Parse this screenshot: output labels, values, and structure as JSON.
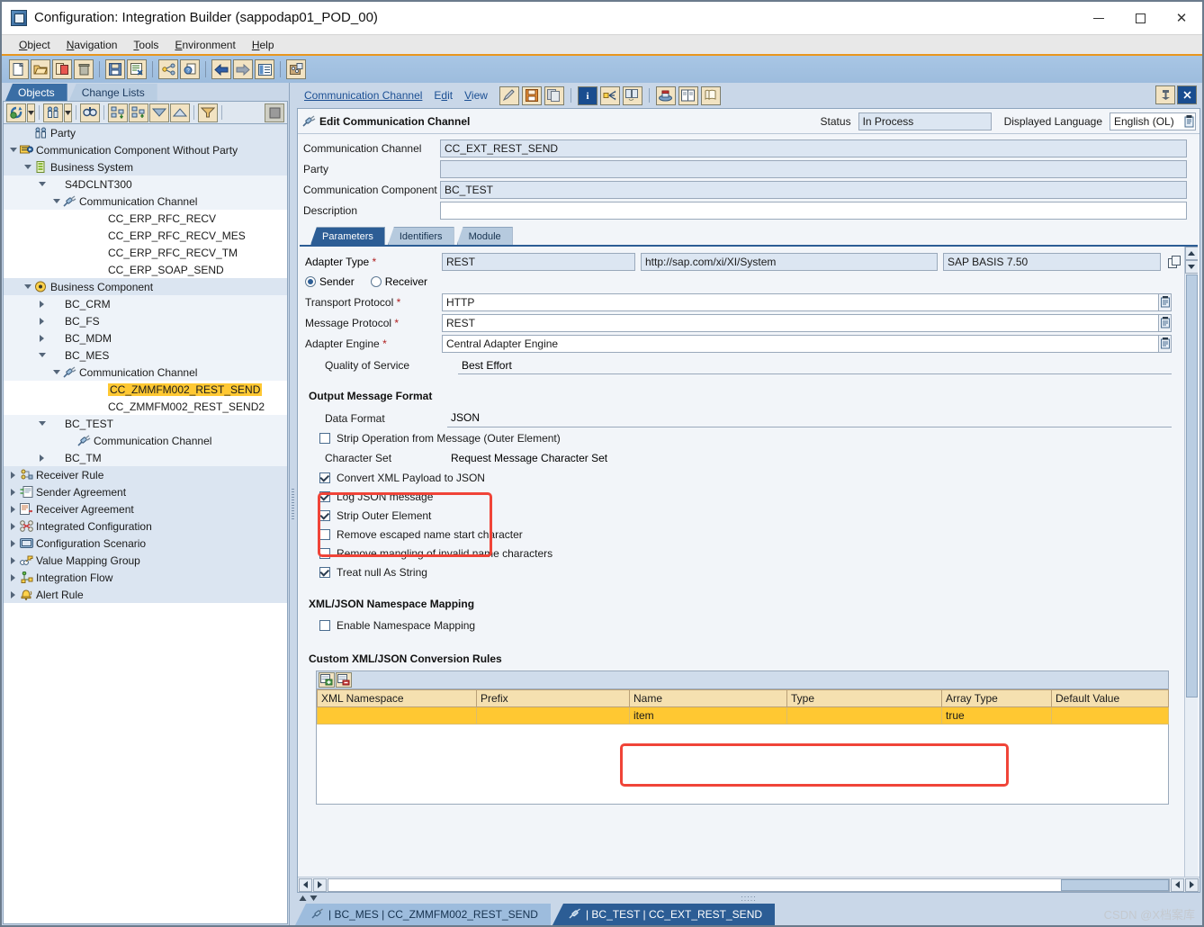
{
  "window": {
    "title": "Configuration: Integration Builder (sappodap01_POD_00)",
    "icon": "app-icon",
    "minimize": "—",
    "maximize": "□",
    "close": "✕"
  },
  "menubar": {
    "items": [
      {
        "label": "Object",
        "accel": "O"
      },
      {
        "label": "Navigation",
        "accel": "N"
      },
      {
        "label": "Tools",
        "accel": "T"
      },
      {
        "label": "Environment",
        "accel": "E"
      },
      {
        "label": "Help",
        "accel": "H"
      }
    ]
  },
  "toolbar": {
    "buttons": [
      {
        "name": "new-icon"
      },
      {
        "name": "open-icon"
      },
      {
        "name": "copy-icon"
      },
      {
        "name": "delete-icon"
      },
      {
        "name": "save-icon"
      },
      {
        "name": "activate-icon"
      },
      {
        "name": "where-used-icon"
      },
      {
        "name": "help-object-icon"
      },
      {
        "name": "back-icon"
      },
      {
        "name": "forward-icon"
      },
      {
        "name": "list-icon"
      },
      {
        "name": "settings-icon"
      }
    ]
  },
  "left_panel": {
    "tabs": [
      {
        "label": "Objects",
        "active": true
      },
      {
        "label": "Change Lists",
        "active": false
      }
    ],
    "toolbar_buttons": [
      {
        "name": "refresh-icon"
      },
      {
        "name": "refresh-dropdown-icon"
      },
      {
        "name": "party-filter-icon"
      },
      {
        "name": "party-dropdown-icon"
      },
      {
        "name": "find-icon"
      },
      {
        "name": "expand-tree-icon"
      },
      {
        "name": "collapse-tree-icon"
      },
      {
        "name": "move-down-icon"
      },
      {
        "name": "move-up-icon"
      },
      {
        "name": "filter-icon"
      },
      {
        "name": "stop-icon"
      }
    ],
    "tree": [
      {
        "label": "Party",
        "indent": 1,
        "twist": "none",
        "icon": "party-icon",
        "shade": "shade"
      },
      {
        "label": "Communication Component Without Party",
        "indent": 0,
        "twist": "down",
        "icon": "component-icon",
        "shade": "shade"
      },
      {
        "label": "Business System",
        "indent": 1,
        "twist": "down",
        "icon": "business-system-icon",
        "shade": "shade"
      },
      {
        "label": "S4DCLNT300",
        "indent": 2,
        "twist": "down",
        "icon": "none",
        "shade": "shade2"
      },
      {
        "label": "Communication Channel",
        "indent": 3,
        "twist": "down",
        "icon": "channel-icon",
        "shade": "shade2"
      },
      {
        "label": "CC_ERP_RFC_RECV",
        "indent": 5,
        "twist": "none",
        "icon": "none",
        "shade": "plainw"
      },
      {
        "label": "CC_ERP_RFC_RECV_MES",
        "indent": 5,
        "twist": "none",
        "icon": "none",
        "shade": "plainw"
      },
      {
        "label": "CC_ERP_RFC_RECV_TM",
        "indent": 5,
        "twist": "none",
        "icon": "none",
        "shade": "plainw"
      },
      {
        "label": "CC_ERP_SOAP_SEND",
        "indent": 5,
        "twist": "none",
        "icon": "none",
        "shade": "plainw"
      },
      {
        "label": "Business Component",
        "indent": 1,
        "twist": "down",
        "icon": "business-component-icon",
        "shade": "shade"
      },
      {
        "label": "BC_CRM",
        "indent": 2,
        "twist": "right",
        "icon": "none",
        "shade": "shade2"
      },
      {
        "label": "BC_FS",
        "indent": 2,
        "twist": "right",
        "icon": "none",
        "shade": "shade2"
      },
      {
        "label": "BC_MDM",
        "indent": 2,
        "twist": "right",
        "icon": "none",
        "shade": "shade2"
      },
      {
        "label": "BC_MES",
        "indent": 2,
        "twist": "down",
        "icon": "none",
        "shade": "shade2"
      },
      {
        "label": "Communication Channel",
        "indent": 3,
        "twist": "down",
        "icon": "channel-icon",
        "shade": "shade2"
      },
      {
        "label": "CC_ZMMFM002_REST_SEND",
        "indent": 5,
        "twist": "none",
        "icon": "none",
        "shade": "plainw",
        "highlight": true
      },
      {
        "label": "CC_ZMMFM002_REST_SEND2",
        "indent": 5,
        "twist": "none",
        "icon": "none",
        "shade": "plainw"
      },
      {
        "label": "BC_TEST",
        "indent": 2,
        "twist": "down",
        "icon": "none",
        "shade": "shade2"
      },
      {
        "label": "Communication Channel",
        "indent": 4,
        "twist": "none",
        "icon": "channel-icon",
        "shade": "shade2"
      },
      {
        "label": "BC_TM",
        "indent": 2,
        "twist": "right",
        "icon": "none",
        "shade": "shade2"
      },
      {
        "label": "Receiver Rule",
        "indent": 0,
        "twist": "right",
        "icon": "receiver-rule-icon",
        "shade": "shade"
      },
      {
        "label": "Sender Agreement",
        "indent": 0,
        "twist": "right",
        "icon": "sender-agreement-icon",
        "shade": "shade"
      },
      {
        "label": "Receiver Agreement",
        "indent": 0,
        "twist": "right",
        "icon": "receiver-agreement-icon",
        "shade": "shade"
      },
      {
        "label": "Integrated Configuration",
        "indent": 0,
        "twist": "right",
        "icon": "integrated-config-icon",
        "shade": "shade"
      },
      {
        "label": "Configuration Scenario",
        "indent": 0,
        "twist": "right",
        "icon": "config-scenario-icon",
        "shade": "shade"
      },
      {
        "label": "Value Mapping Group",
        "indent": 0,
        "twist": "right",
        "icon": "value-mapping-icon",
        "shade": "shade"
      },
      {
        "label": "Integration Flow",
        "indent": 0,
        "twist": "right",
        "icon": "integration-flow-icon",
        "shade": "shade"
      },
      {
        "label": "Alert Rule",
        "indent": 0,
        "twist": "right",
        "icon": "alert-rule-icon",
        "shade": "shade"
      }
    ]
  },
  "right_panel": {
    "menus": [
      {
        "label": "Communication Channel",
        "accel": "C"
      },
      {
        "label": "Edit",
        "accel": "d"
      },
      {
        "label": "View",
        "accel": "V"
      }
    ],
    "toolbar_buttons": [
      {
        "name": "edit-mode-icon"
      },
      {
        "name": "save-icon"
      },
      {
        "name": "copy-icon"
      },
      {
        "name": "info-icon"
      },
      {
        "name": "where-used-icon"
      },
      {
        "name": "history-icon"
      },
      {
        "name": "cache-status-icon"
      },
      {
        "name": "documentation-icon"
      },
      {
        "name": "log-icon"
      },
      {
        "name": "pin-icon"
      },
      {
        "name": "close-editor-icon"
      }
    ],
    "header": {
      "icon": "channel-icon",
      "title": "Edit Communication Channel",
      "status_label": "Status",
      "status_value": "In Process",
      "language_label": "Displayed Language",
      "language_value": "English (OL)"
    },
    "fields": [
      {
        "label": "Communication Channel",
        "value": "CC_EXT_REST_SEND",
        "readonly": true
      },
      {
        "label": "Party",
        "value": "",
        "readonly": true
      },
      {
        "label": "Communication Component",
        "value": "BC_TEST",
        "readonly": true
      },
      {
        "label": "Description",
        "value": "",
        "readonly": false
      }
    ],
    "tabs": [
      {
        "label": "Parameters",
        "active": true
      },
      {
        "label": "Identifiers",
        "active": false
      },
      {
        "label": "Module",
        "active": false
      }
    ],
    "parameters": {
      "adapter_type": {
        "label": "Adapter Type",
        "required": true,
        "value": "REST",
        "namespace": "http://sap.com/xi/XI/System",
        "swcv": "SAP BASIS 7.50",
        "browse_icon": "select-adapter-icon"
      },
      "direction": {
        "sender_label": "Sender",
        "receiver_label": "Receiver",
        "selected": "Sender"
      },
      "transport_protocol": {
        "label": "Transport Protocol",
        "required": true,
        "value": "HTTP"
      },
      "message_protocol": {
        "label": "Message Protocol",
        "required": true,
        "value": "REST"
      },
      "adapter_engine": {
        "label": "Adapter Engine",
        "required": true,
        "value": "Central Adapter Engine"
      },
      "quality_of_service": {
        "label": "Quality of Service",
        "value": "Best Effort"
      },
      "output_message_format": {
        "title": "Output Message Format",
        "data_format": {
          "label": "Data Format",
          "value": "JSON"
        },
        "strip_operation": {
          "label": "Strip Operation from Message (Outer Element)",
          "checked": false
        },
        "character_set": {
          "label": "Character Set",
          "value": "Request Message Character Set"
        },
        "checkboxes": [
          {
            "label": "Convert XML Payload to JSON",
            "checked": true,
            "highlighted": true
          },
          {
            "label": "Log JSON message",
            "checked": true,
            "highlighted": true
          },
          {
            "label": "Strip Outer Element",
            "checked": true,
            "highlighted": true
          },
          {
            "label": "Remove escaped name start character",
            "checked": false,
            "highlighted": false
          },
          {
            "label": "Remove mangling of invalid name characters",
            "checked": false,
            "highlighted": false
          },
          {
            "label": "Treat null As String",
            "checked": true,
            "highlighted": false
          }
        ]
      },
      "namespace_mapping": {
        "title": "XML/JSON Namespace Mapping",
        "enable": {
          "label": "Enable Namespace Mapping",
          "checked": false
        }
      },
      "conversion_rules": {
        "title": "Custom XML/JSON Conversion Rules",
        "toolbar": [
          {
            "name": "insert-row-icon"
          },
          {
            "name": "delete-row-icon"
          }
        ],
        "columns": [
          "XML Namespace",
          "Prefix",
          "Name",
          "Type",
          "Array Type",
          "Default Value"
        ],
        "rows": [
          [
            "",
            "",
            "item",
            "",
            "true",
            ""
          ]
        ]
      }
    }
  },
  "doc_tabs": [
    {
      "label": "| BC_MES | CC_ZMMFM002_REST_SEND",
      "icon": "channel-icon",
      "active": false
    },
    {
      "label": "| BC_TEST | CC_EXT_REST_SEND",
      "icon": "channel-icon",
      "active": true
    }
  ],
  "watermark": "CSDN @X档案库",
  "colors": {
    "accent": "#2c5d95",
    "highlight_row": "#ffc832",
    "annotation": "#f04438",
    "toolbar_btn": "#f2e3c2",
    "readonly_field": "#dce6f2"
  }
}
